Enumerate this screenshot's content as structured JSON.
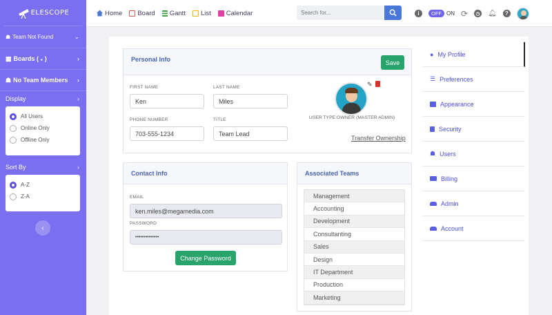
{
  "app": {
    "logo": "ELESCOPE"
  },
  "sidebar": {
    "team": "Team Not Found",
    "boards": "Boards (",
    "boards_suffix": " )",
    "no_team_members": "No Team Members",
    "display_title": "Display",
    "display_options": [
      "All Users",
      "Online Only",
      "Offline Only"
    ],
    "sort_title": "Sort By",
    "sort_options": [
      "A-Z",
      "Z-A"
    ]
  },
  "nav": {
    "home": "Home",
    "board": "Board",
    "gantt": "Gantt",
    "list": "List",
    "calendar": "Calendar",
    "colors": {
      "home": "#4a78d8",
      "board": "#e0554a",
      "gantt": "#43a047",
      "list": "#f4b400",
      "calendar": "#e040a0"
    }
  },
  "search": {
    "placeholder": "Search for..."
  },
  "toolbar": {
    "toggle_off": "OFF",
    "toggle_on": "ON"
  },
  "personal": {
    "title": "Personal Info",
    "save": "Save",
    "first_name_label": "FIRST NAME",
    "first_name": "Ken",
    "last_name_label": "LAST NAME",
    "last_name": "Miles",
    "phone_label": "PHONE NUMBER",
    "phone": "703-555-1234",
    "title_label": "TITLE",
    "title_value": "Team Lead",
    "user_type": "USER TYPE:OWNER (MASTER ADMIN)",
    "transfer": "Transfer Ownership"
  },
  "contact": {
    "title": "Contact Info",
    "email_label": "EMAIL",
    "email": "ken.miles@megamedia.com",
    "password_label": "PASSWORD",
    "password": "••••••••••••••",
    "change_password": "Change Password"
  },
  "teams": {
    "title": "Associated Teams",
    "items": [
      "Management",
      "Accounting",
      "Development",
      "Consultanting",
      "Sales",
      "Design",
      "IT Department",
      "Production",
      "Marketing"
    ]
  },
  "settings_menu": {
    "items": [
      "My Profile",
      "Preferences",
      "Appearance",
      "Security",
      "Users",
      "Billing",
      "Admin",
      "Account"
    ]
  },
  "colors": {
    "accent": "#7a6ff0",
    "green": "#27a36b",
    "link": "#4a4fd8"
  }
}
